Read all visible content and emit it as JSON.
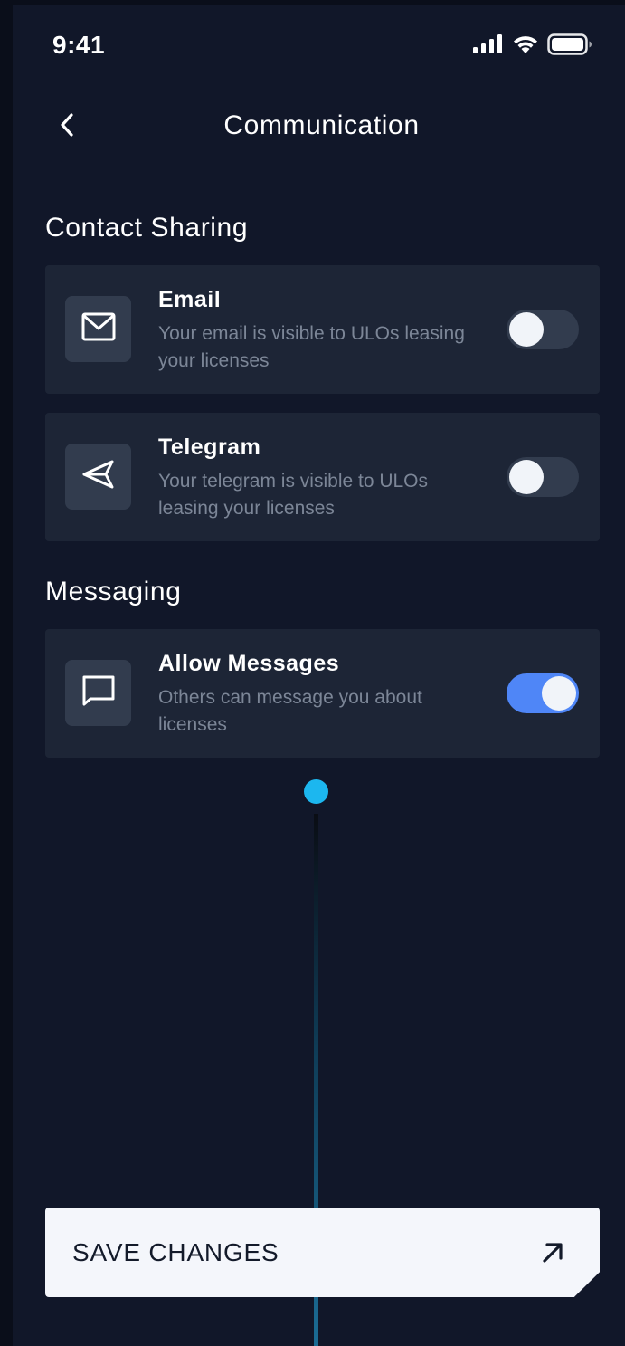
{
  "status_bar": {
    "time": "9:41"
  },
  "header": {
    "title": "Communication"
  },
  "contact_sharing": {
    "title": "Contact Sharing",
    "items": [
      {
        "icon": "mail-icon",
        "title": "Email",
        "description": "Your email is visible to ULOs leasing your licenses",
        "enabled": false
      },
      {
        "icon": "send-icon",
        "title": "Telegram",
        "description": "Your telegram is visible to ULOs leasing your licenses",
        "enabled": false
      }
    ]
  },
  "messaging": {
    "title": "Messaging",
    "items": [
      {
        "icon": "message-icon",
        "title": "Allow Messages",
        "description": "Others can message you about licenses",
        "enabled": true
      }
    ]
  },
  "footer": {
    "save_label": "SAVE CHANGES"
  },
  "colors": {
    "background": "#111729",
    "card": "#1d2536",
    "toggle_on": "#4f86f7",
    "accent_dot": "#1cb7ef",
    "button": "#f4f6fb"
  }
}
